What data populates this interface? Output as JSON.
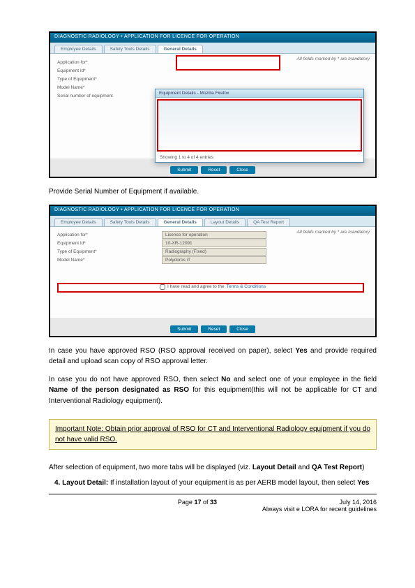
{
  "screenshot1": {
    "header": "DIAGNOSTIC RADIOLOGY • APPLICATION FOR LICENCE FOR OPERATION",
    "tabs": [
      "Employee Details",
      "Safety Tools Details",
      "General Details"
    ],
    "mandatory": "All fields marked by * are mandatory",
    "labels": [
      "Application for*",
      "Equipment Id*",
      "Type of Equipment*",
      "Model Name*",
      "Serial number of equipment"
    ],
    "modal_title": "Equipment Details - Mozilla Firefox",
    "modal_footer": "Showing 1 to 4 of 4 entries",
    "buttons": [
      "Submit",
      "Reset",
      "Close"
    ]
  },
  "caption1": "Provide Serial Number of Equipment if available.",
  "screenshot2": {
    "header": "DIAGNOSTIC RADIOLOGY • APPLICATION FOR LICENCE FOR OPERATION",
    "tabs": [
      "Employee Details",
      "Safety Tools Details",
      "General Details",
      "Layout Details",
      "QA Test Report"
    ],
    "mandatory": "All fields marked by * are mandatory",
    "rows": [
      {
        "label": "Application for*",
        "value": "Licence for operation"
      },
      {
        "label": "Equipment Id*",
        "value": "10-XR-12091"
      },
      {
        "label": "Type of Equipment*",
        "value": "Radiography (Fixed)"
      },
      {
        "label": "Model Name*",
        "value": "Polydoros iT"
      }
    ],
    "terms_prefix": "I have read and agree to the ",
    "terms_link": "Terms & Conditions",
    "buttons": [
      "Submit",
      "Reset",
      "Close"
    ]
  },
  "para1_a": "In case you have approved RSO (RSO approval received on paper), select ",
  "para1_b": "Yes",
  "para1_c": " and provide required detail and upload scan copy of RSO approval letter.",
  "para2_a": "In case you do not have approved RSO, then select ",
  "para2_b": "No",
  "para2_c": " and select one of your employee in the field ",
  "para2_d": "Name of the person designated as RSO",
  "para2_e": " for this equipment(this will not be applicable for CT and Interventional Radiology equipment).",
  "note_a": "Important Note:",
  "note_b": " Obtain prior approval of RSO for CT and Interventional Radiology equipment if you do not have valid RSO.",
  "after_a": "After selection of equipment, two more tabs will be displayed (viz. ",
  "after_b": "Layout Detail",
  "after_c": " and ",
  "after_d": "QA Test Report",
  "after_e": ")",
  "li4_num": "4.",
  "li4_a": "Layout Detail:",
  "li4_b": " If installation layout of your equipment is as per AERB model layout, then select ",
  "li4_c": "Yes",
  "footer": {
    "page_a": "Page ",
    "page_b": "17",
    "page_c": " of ",
    "page_d": "33",
    "date": "July 14, 2016",
    "guide": "Always visit e LORA for recent guidelines"
  }
}
